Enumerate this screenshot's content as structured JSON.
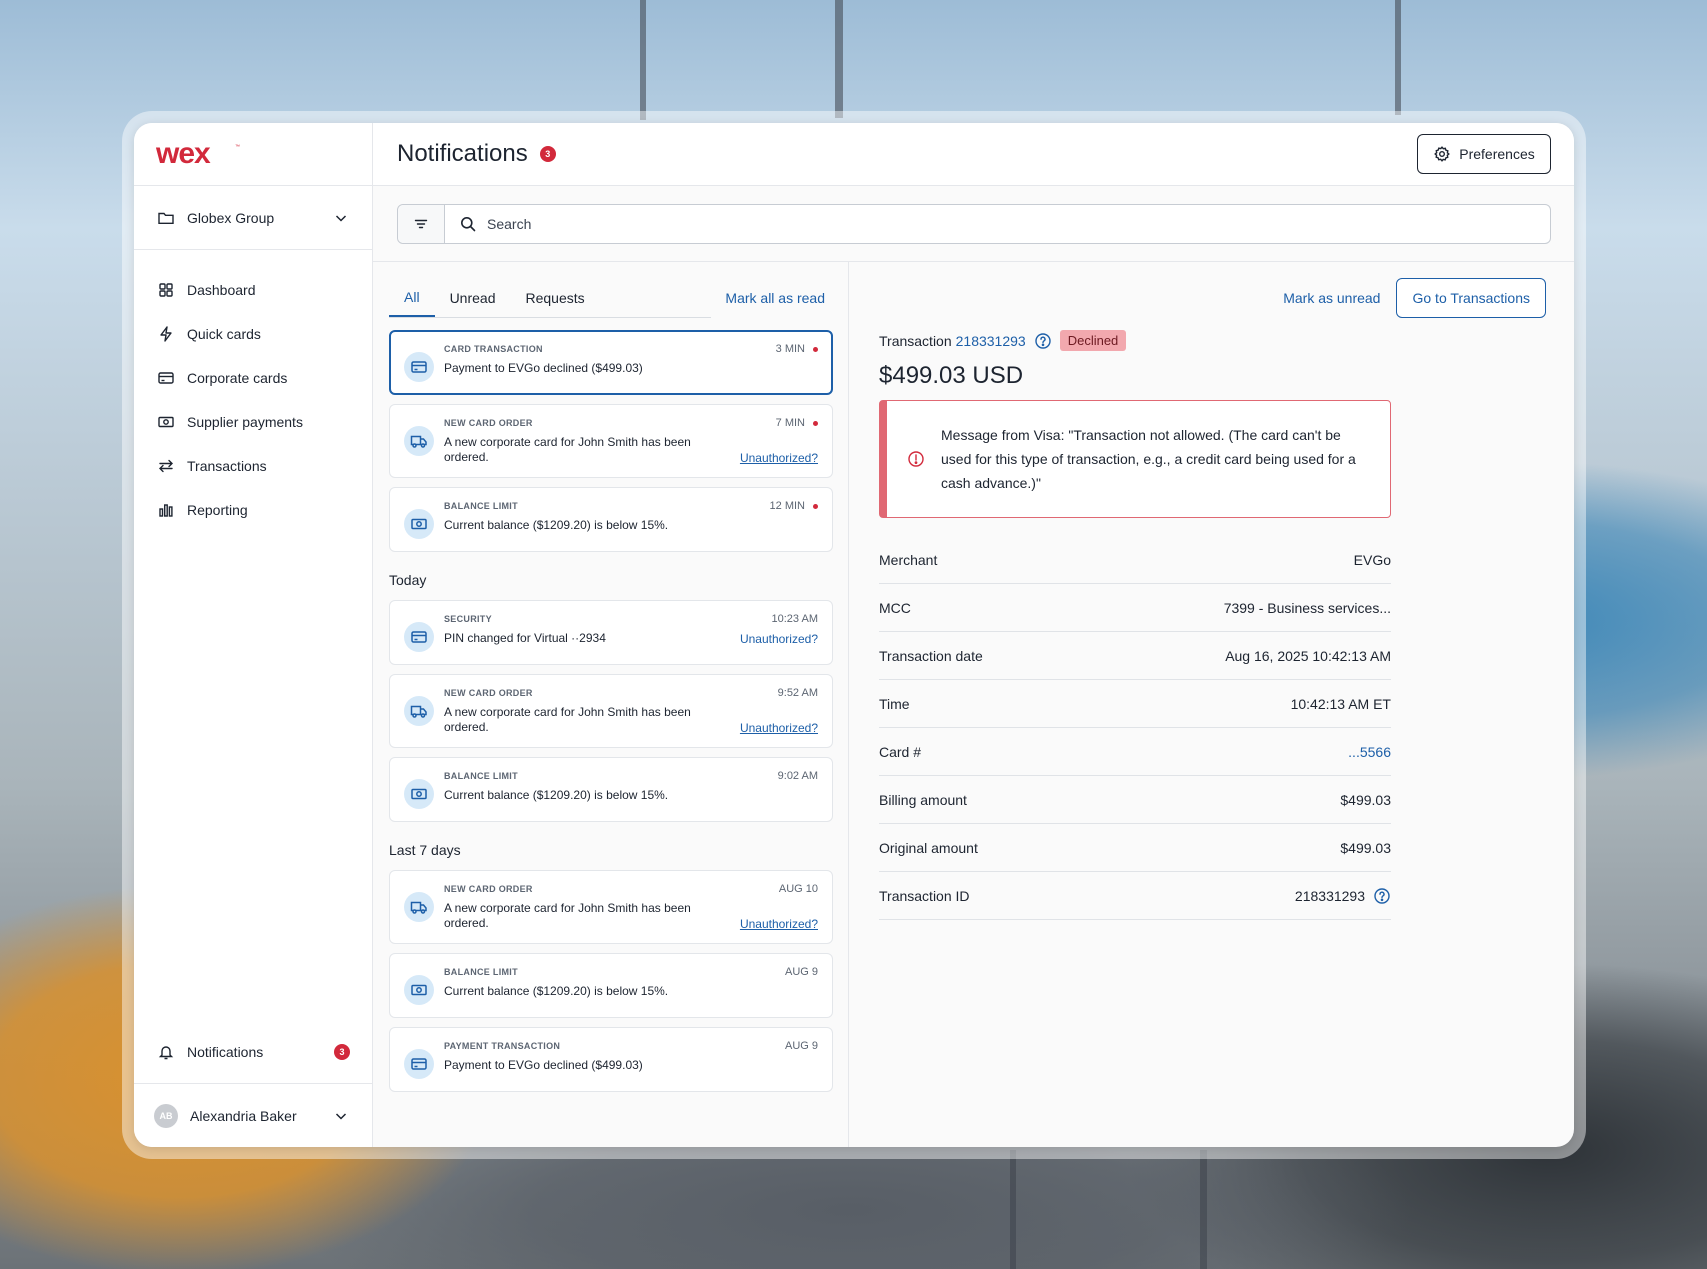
{
  "brand": {
    "logo_text": "wex",
    "accent": "#d2293b",
    "link": "#1d5fa8"
  },
  "sidebar": {
    "org": {
      "label": "Globex Group",
      "icon": "folder-icon"
    },
    "items": [
      {
        "label": "Dashboard",
        "icon": "grid-icon"
      },
      {
        "label": "Quick cards",
        "icon": "lightning-icon"
      },
      {
        "label": "Corporate cards",
        "icon": "credit-card-icon"
      },
      {
        "label": "Supplier payments",
        "icon": "money-icon"
      },
      {
        "label": "Transactions",
        "icon": "arrows-icon"
      },
      {
        "label": "Reporting",
        "icon": "bar-chart-icon"
      }
    ],
    "notifications": {
      "label": "Notifications",
      "count": "3",
      "icon": "bell-icon"
    },
    "user": {
      "name": "Alexandria Baker",
      "initials": "AB"
    }
  },
  "header": {
    "title": "Notifications",
    "count": "3",
    "preferences_label": "Preferences"
  },
  "search": {
    "placeholder": "Search"
  },
  "tabs": [
    {
      "label": "All"
    },
    {
      "label": "Unread"
    },
    {
      "label": "Requests"
    }
  ],
  "mark_all_label": "Mark all as read",
  "notifications": {
    "recent": [
      {
        "category": "CARD TRANSACTION",
        "time": "3 MIN",
        "message": "Payment to EVGo declined ($499.03)",
        "icon": "credit-card-icon",
        "unread": true
      },
      {
        "category": "NEW CARD ORDER",
        "time": "7 MIN",
        "message": "A new corporate card for John Smith has been ordered.",
        "action": "Unauthorized?",
        "icon": "truck-icon",
        "unread": true
      },
      {
        "category": "BALANCE LIMIT",
        "time": "12 MIN",
        "message": "Current balance ($1209.20) is below 15%.",
        "icon": "money-icon",
        "unread": true
      }
    ],
    "today_label": "Today",
    "today": [
      {
        "category": "SECURITY",
        "time": "10:23 AM",
        "message": "PIN changed for Virtual ··2934",
        "action": "Unauthorized?",
        "icon": "credit-card-icon"
      },
      {
        "category": "NEW CARD ORDER",
        "time": "9:52 AM",
        "message": "A new corporate card for John Smith has been ordered.",
        "action": "Unauthorized?",
        "icon": "truck-icon"
      },
      {
        "category": "BALANCE LIMIT",
        "time": "9:02 AM",
        "message": "Current balance ($1209.20) is below 15%.",
        "icon": "money-icon"
      }
    ],
    "week_label": "Last 7 days",
    "week": [
      {
        "category": "NEW CARD ORDER",
        "time": "AUG 10",
        "message": "A new corporate card for John Smith has been ordered.",
        "action": "Unauthorized?",
        "icon": "truck-icon"
      },
      {
        "category": "BALANCE LIMIT",
        "time": "AUG 9",
        "message": "Current balance ($1209.20) is below 15%.",
        "icon": "money-icon"
      },
      {
        "category": "PAYMENT TRANSACTION",
        "time": "AUG 9",
        "message": "Payment to EVGo declined ($499.03)",
        "icon": "credit-card-icon"
      }
    ]
  },
  "detail": {
    "mark_unread_label": "Mark as unread",
    "go_label": "Go to Transactions",
    "transaction_label": "Transaction",
    "transaction_id": "218331293",
    "status": "Declined",
    "amount": "$499.03 USD",
    "alert_message": "Message from Visa: \"Transaction not allowed. (The card can't be used for this type of transaction, e.g., a credit card being used for a cash advance.)\"",
    "rows": [
      {
        "label": "Merchant",
        "value": "EVGo"
      },
      {
        "label": "MCC",
        "value": "7399 - Business services..."
      },
      {
        "label": "Transaction date",
        "value": "Aug 16, 2025 10:42:13 AM"
      },
      {
        "label": "Time",
        "value": "10:42:13 AM ET"
      },
      {
        "label": "Card #",
        "value": "...5566",
        "link": true
      },
      {
        "label": "Billing amount",
        "value": "$499.03"
      },
      {
        "label": "Original amount",
        "value": "$499.03"
      },
      {
        "label": "Transaction ID",
        "value": "218331293",
        "help": true
      }
    ]
  }
}
